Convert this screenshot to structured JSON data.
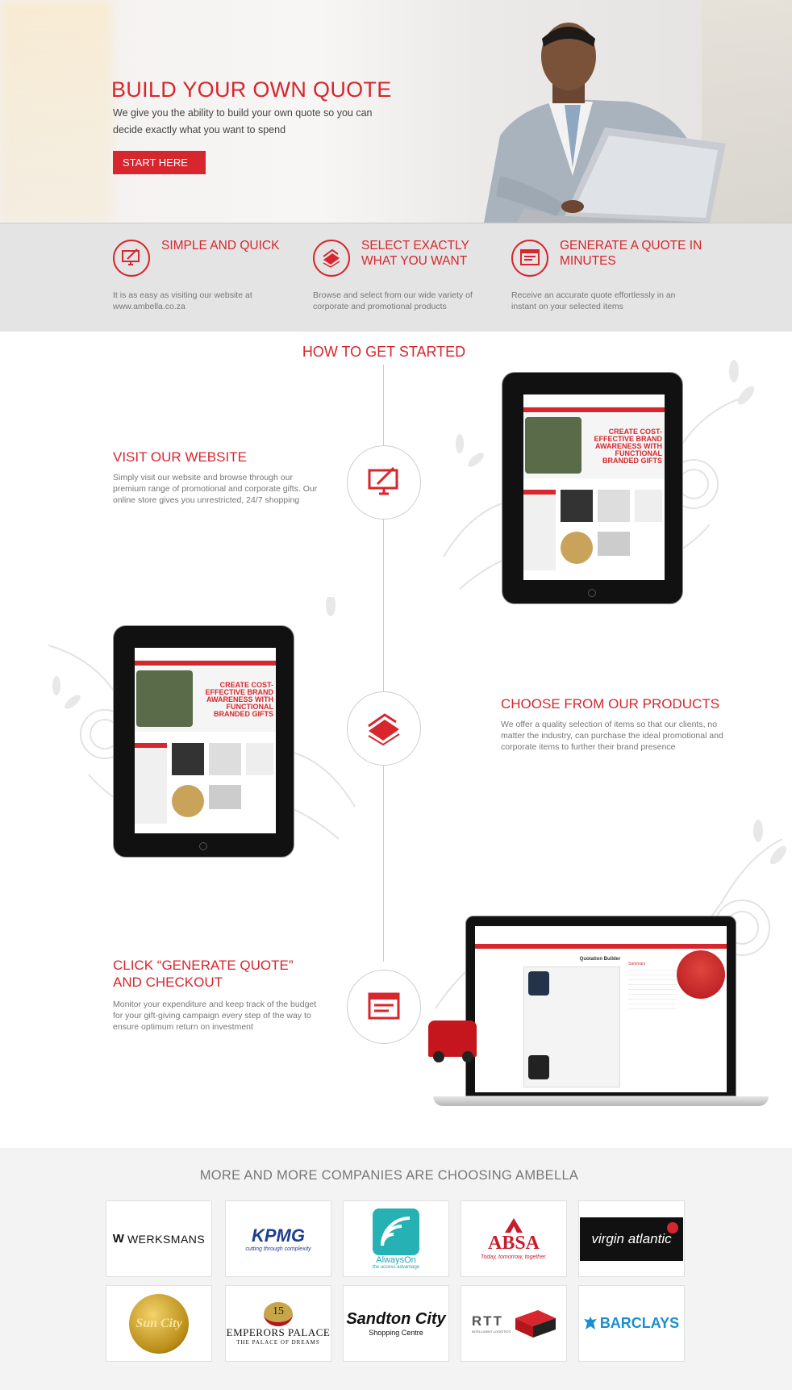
{
  "hero": {
    "title": "BUILD YOUR OWN QUOTE",
    "subtitle": "We give you the ability to build your own quote so you can decide exactly what you want to spend",
    "cta_label": "START HERE"
  },
  "features": [
    {
      "title": "SIMPLE AND QUICK",
      "text": "It is as easy as visiting our website at www.ambella.co.za",
      "icon": "monitor-pen-icon"
    },
    {
      "title": "SELECT EXACTLY WHAT YOU WANT",
      "text": "Browse and select from our wide variety of corporate and promotional products",
      "icon": "swatches-icon"
    },
    {
      "title": "GENERATE A QUOTE IN MINUTES",
      "text": "Receive an accurate quote effortlessly in an instant on your selected items",
      "icon": "quote-document-icon"
    }
  ],
  "howto": {
    "title": "HOW TO GET STARTED",
    "steps": [
      {
        "title": "VISIT OUR WEBSITE",
        "text": "Simply visit our website and browse through our premium range of promotional and corporate gifts. Our online store gives you unrestricted, 24/7 shopping",
        "icon": "monitor-pen-icon"
      },
      {
        "title": "CHOOSE FROM OUR PRODUCTS",
        "text": "We offer a quality selection of items so that our clients, no matter the industry, can purchase the ideal promotional and corporate items to further their brand presence",
        "icon": "swatches-icon"
      },
      {
        "title": "CLICK “GENERATE QUOTE” AND CHECKOUT",
        "text": "Monitor your expenditure and keep track of the budget for your gift-giving campaign every step of the way to ensure optimum return on investment",
        "icon": "quote-document-icon"
      }
    ]
  },
  "screens": {
    "hero_banner": "CREATE COST-EFFECTIVE BRAND AWARENESS WITH FUNCTIONAL BRANDED GIFTS",
    "quote_title": "Quotation Builder",
    "summary_label": "Summary"
  },
  "clients": {
    "title": "MORE AND MORE COMPANIES ARE CHOOSING AMBELLA",
    "logos": [
      {
        "name": "WERKSMANS"
      },
      {
        "name": "KPMG",
        "tagline": "cutting through complexity"
      },
      {
        "name": "AlwaysOn",
        "tagline": "the access advantage"
      },
      {
        "name": "ABSA",
        "tagline": "Today, tomorrow, together."
      },
      {
        "name": "virgin atlantic"
      },
      {
        "name": "Sun City"
      },
      {
        "name": "EMPERORS PALACE",
        "tagline": "THE PALACE OF DREAMS",
        "badge": "15"
      },
      {
        "name": "Sandton City",
        "tagline": "Shopping Centre"
      },
      {
        "name": "RTT",
        "tagline": "INTELLIGENT LOGISTICS"
      },
      {
        "name": "BARCLAYS"
      }
    ]
  },
  "colors": {
    "accent": "#d7262d",
    "band": "#e4e4e4"
  }
}
